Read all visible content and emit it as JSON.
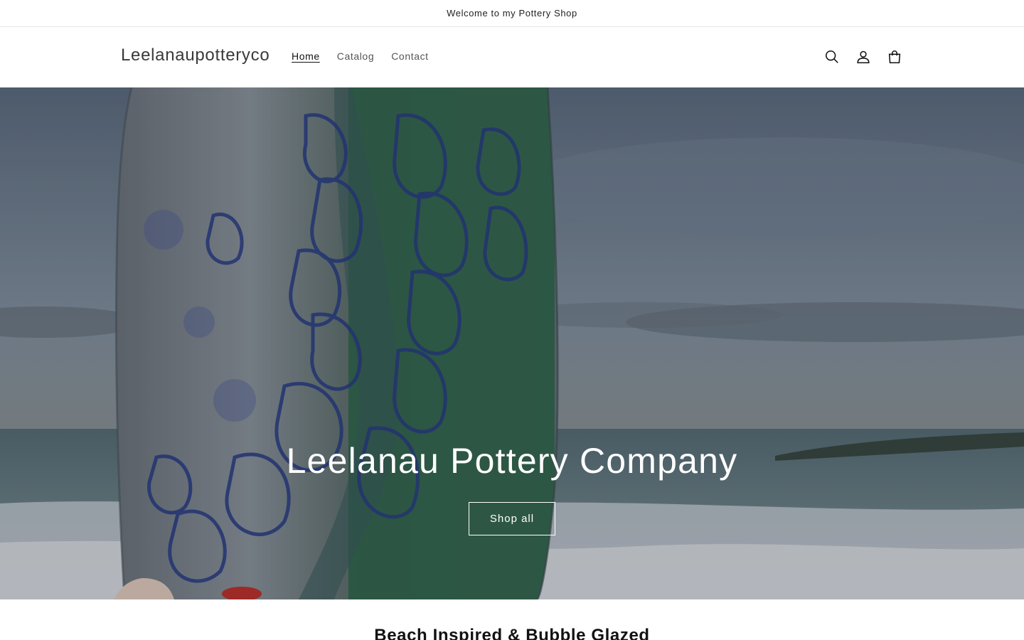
{
  "announcement": {
    "text": "Welcome to my Pottery Shop"
  },
  "header": {
    "logo": "Leelanaupotteryco",
    "nav": [
      {
        "label": "Home",
        "active": true
      },
      {
        "label": "Catalog",
        "active": false
      },
      {
        "label": "Contact",
        "active": false
      }
    ],
    "icons": [
      "search-icon",
      "account-icon",
      "cart-icon"
    ]
  },
  "hero": {
    "title": "Leelanau Pottery Company",
    "button_label": "Shop all"
  },
  "section": {
    "heading": "Beach Inspired & Bubble Glazed"
  },
  "colors": {
    "text": "#121212",
    "sky": "#6f7d8a",
    "water": "#5a6b73",
    "glaze_green": "#2f6a4e",
    "glaze_blue": "#2a3f8a"
  }
}
